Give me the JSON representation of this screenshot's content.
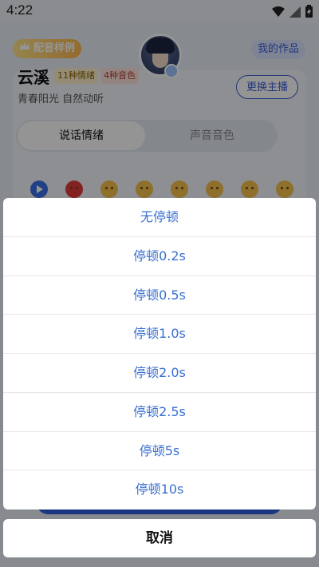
{
  "status_bar": {
    "time": "4:22"
  },
  "header": {
    "sample_badge": "配音样例",
    "my_works": "我的作品"
  },
  "speaker": {
    "name": "云溪",
    "tags": [
      "11种情绪",
      "4种音色"
    ],
    "description": "青春阳光 自然动听",
    "switch_label": "更换主播"
  },
  "tabs": [
    "说话情绪",
    "声音音色"
  ],
  "action_sheet": {
    "options": [
      "无停顿",
      "停顿0.2s",
      "停顿0.5s",
      "停顿1.0s",
      "停顿2.0s",
      "停顿2.5s",
      "停顿5s",
      "停顿10s"
    ],
    "cancel_label": "取消"
  },
  "colors": {
    "accent": "#3a6fd0",
    "option_text": "#3a6fd0",
    "overlay": "rgba(0,0,0,0.42)"
  },
  "icons": [
    "wifi-icon",
    "signal-icon",
    "battery-icon",
    "play-icon",
    "crown-icon",
    "avatar"
  ]
}
